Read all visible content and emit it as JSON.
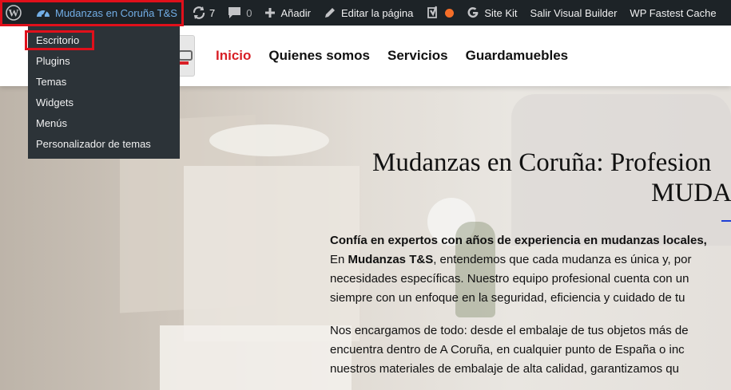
{
  "adminbar": {
    "site_name": "Mudanzas en Coruña T&S",
    "updates_count": "7",
    "comments_count": "0",
    "add_label": "Añadir",
    "edit_label": "Editar la página",
    "sitekit_label": "Site Kit",
    "visual_builder_label": "Salir Visual Builder",
    "cache_label": "WP Fastest Cache"
  },
  "dropdown": {
    "items": [
      "Escritorio",
      "Plugins",
      "Temas",
      "Widgets",
      "Menús",
      "Personalizador de temas"
    ]
  },
  "nav": {
    "items": [
      "Inicio",
      "Quienes somos",
      "Servicios",
      "Guardamuebles"
    ]
  },
  "hero": {
    "title_line1": "Mudanzas en Coruña: Profesion",
    "title_line2": "MUDA",
    "p1_bold": "Confía en expertos con años de experiencia en mudanzas locales, ",
    "p1_l2_pre": "En ",
    "p1_l2_bold": "Mudanzas T&S",
    "p1_l2_post": ", entendemos que cada mudanza es única y, por",
    "p1_l3": "necesidades específicas. Nuestro equipo profesional cuenta con un",
    "p1_l4": "siempre con un enfoque en la seguridad, eficiencia y cuidado de tu",
    "p2_l1": "Nos encargamos de todo: desde el embalaje de tus objetos más de",
    "p2_l2": "encuentra dentro de A Coruña, en cualquier punto de España o inc",
    "p2_l3": "nuestros materiales de embalaje de alta calidad, garantizamos qu"
  },
  "colors": {
    "adminbar_bg": "#1d2327",
    "dropdown_bg": "#2c3338",
    "site_link": "#72aee6",
    "highlight": "#e0101b",
    "nav_active": "#d81f26"
  },
  "icons": [
    "wordpress-icon",
    "dashboard-icon",
    "updates-icon",
    "comment-icon",
    "plus-icon",
    "pencil-icon",
    "yoast-icon",
    "google-icon"
  ]
}
